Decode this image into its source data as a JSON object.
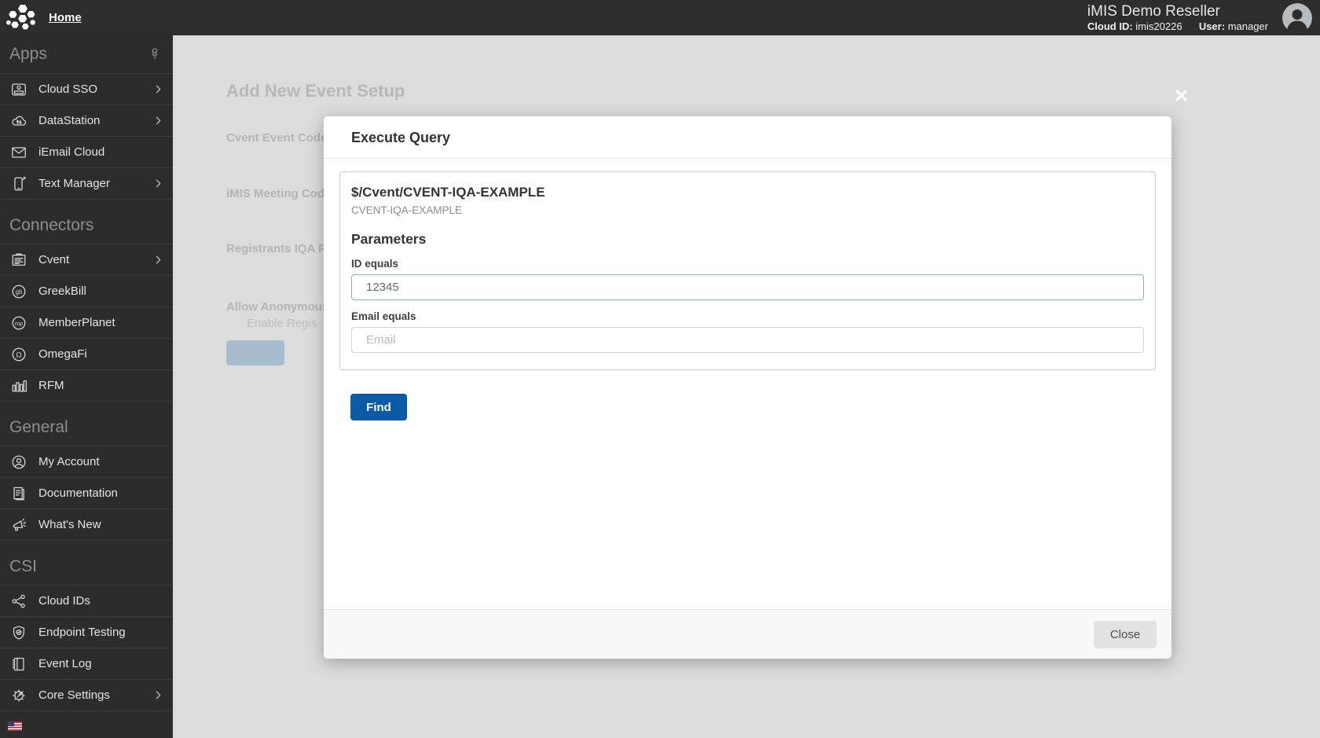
{
  "topbar": {
    "home": "Home",
    "app_title": "iMIS Demo Reseller",
    "cloud_id_label": "Cloud ID:",
    "cloud_id_value": "imis20226",
    "user_label": "User:",
    "user_value": "manager"
  },
  "sidebar": {
    "sections": [
      {
        "label": "Apps",
        "pin_icon": "pin-icon",
        "items": [
          {
            "label": "Cloud SSO",
            "icon": "id-card-icon",
            "chevron": true
          },
          {
            "label": "DataStation",
            "icon": "cloud-transfer-icon",
            "chevron": true
          },
          {
            "label": "iEmail Cloud",
            "icon": "envelope-icon",
            "chevron": false
          },
          {
            "label": "Text Manager",
            "icon": "phone-edit-icon",
            "chevron": true
          }
        ]
      },
      {
        "label": "Connectors",
        "items": [
          {
            "label": "Cvent",
            "icon": "form-document-icon",
            "chevron": true
          },
          {
            "label": "GreekBill",
            "icon": "greekbill-badge-icon",
            "chevron": false
          },
          {
            "label": "MemberPlanet",
            "icon": "memberplanet-badge-icon",
            "chevron": false
          },
          {
            "label": "OmegaFi",
            "icon": "omegafi-badge-icon",
            "chevron": false
          },
          {
            "label": "RFM",
            "icon": "bar-chart-icon",
            "chevron": false
          }
        ]
      },
      {
        "label": "General",
        "items": [
          {
            "label": "My Account",
            "icon": "user-circle-icon",
            "chevron": false
          },
          {
            "label": "Documentation",
            "icon": "documents-icon",
            "chevron": false
          },
          {
            "label": "What's New",
            "icon": "megaphone-icon",
            "chevron": false
          }
        ]
      },
      {
        "label": "CSI",
        "items": [
          {
            "label": "Cloud IDs",
            "icon": "share-nodes-icon",
            "chevron": false
          },
          {
            "label": "Endpoint Testing",
            "icon": "shield-check-icon",
            "chevron": false
          },
          {
            "label": "Event Log",
            "icon": "notebook-icon",
            "chevron": false
          },
          {
            "label": "Core Settings",
            "icon": "gear-wrench-icon",
            "chevron": true
          }
        ]
      }
    ],
    "language_flag": "us-flag-icon"
  },
  "background_page": {
    "title": "Add New Event Setup",
    "labels": [
      "Cvent Event Code",
      "iMIS Meeting Code",
      "Registrants IQA Pa",
      "Allow Anonymous",
      "Enable Regis"
    ]
  },
  "modal": {
    "title": "Execute Query",
    "query_path": "$/Cvent/CVENT-IQA-EXAMPLE",
    "query_name": "CVENT-IQA-EXAMPLE",
    "parameters_heading": "Parameters",
    "fields": [
      {
        "label": "ID equals",
        "value": "12345",
        "placeholder": "",
        "focused": true
      },
      {
        "label": "Email equals",
        "value": "",
        "placeholder": "Email",
        "focused": false
      }
    ],
    "find_button": "Find",
    "close_button": "Close"
  },
  "colors": {
    "topbar_bg": "#2e2d2e",
    "accent_blue": "#0b5aa6",
    "focus_border": "#7fb2d9",
    "overlay_gray": "#dcdcdc"
  }
}
